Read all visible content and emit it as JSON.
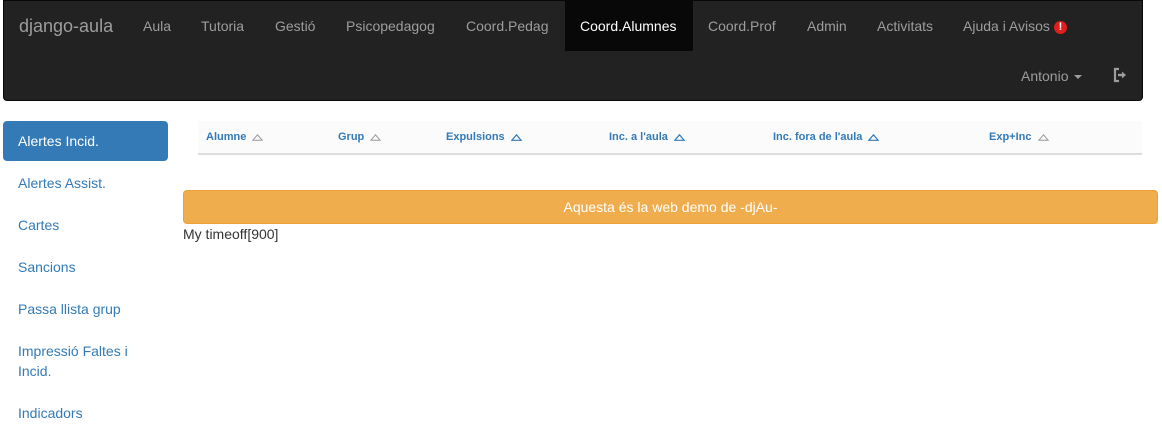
{
  "navbar": {
    "brand": "django-aula",
    "items": [
      {
        "label": "Aula"
      },
      {
        "label": "Tutoria"
      },
      {
        "label": "Gestió"
      },
      {
        "label": "Psicopedagog"
      },
      {
        "label": "Coord.Pedag"
      },
      {
        "label": "Coord.Alumnes"
      },
      {
        "label": "Coord.Prof"
      },
      {
        "label": "Admin"
      },
      {
        "label": "Activitats"
      },
      {
        "label": "Ajuda i Avisos"
      }
    ],
    "active_item": "Coord.Alumnes",
    "alert_icon": "exclamation-circle-icon",
    "user": "Antonio",
    "logout_icon": "sign-out-icon"
  },
  "sidebar": {
    "items": [
      {
        "label": "Alertes Incid."
      },
      {
        "label": "Alertes Assist."
      },
      {
        "label": "Cartes"
      },
      {
        "label": "Sancions"
      },
      {
        "label": "Passa llista grup"
      },
      {
        "label": "Impressió Faltes i Incid."
      },
      {
        "label": "Indicadors"
      }
    ],
    "active_item": "Alertes Incid."
  },
  "table": {
    "headers": [
      {
        "label": "Alumne",
        "sort": "neutral"
      },
      {
        "label": "Grup",
        "sort": "neutral"
      },
      {
        "label": "Expulsions",
        "sort": "ascending"
      },
      {
        "label": "Inc. a l'aula",
        "sort": "ascending"
      },
      {
        "label": "Inc. fora de l'aula",
        "sort": "ascending"
      },
      {
        "label": "Exp+Inc",
        "sort": "neutral"
      }
    ],
    "rows": []
  },
  "banner": {
    "text": "Aquesta és la web demo de -djAu-"
  },
  "footer_text": "My timeoff[900]",
  "colors": {
    "navbar_bg": "#222222",
    "navbar_active_bg": "#080808",
    "link": "#337ab7",
    "warning": "#f0ad4e",
    "alert_red": "#e11d1d"
  }
}
